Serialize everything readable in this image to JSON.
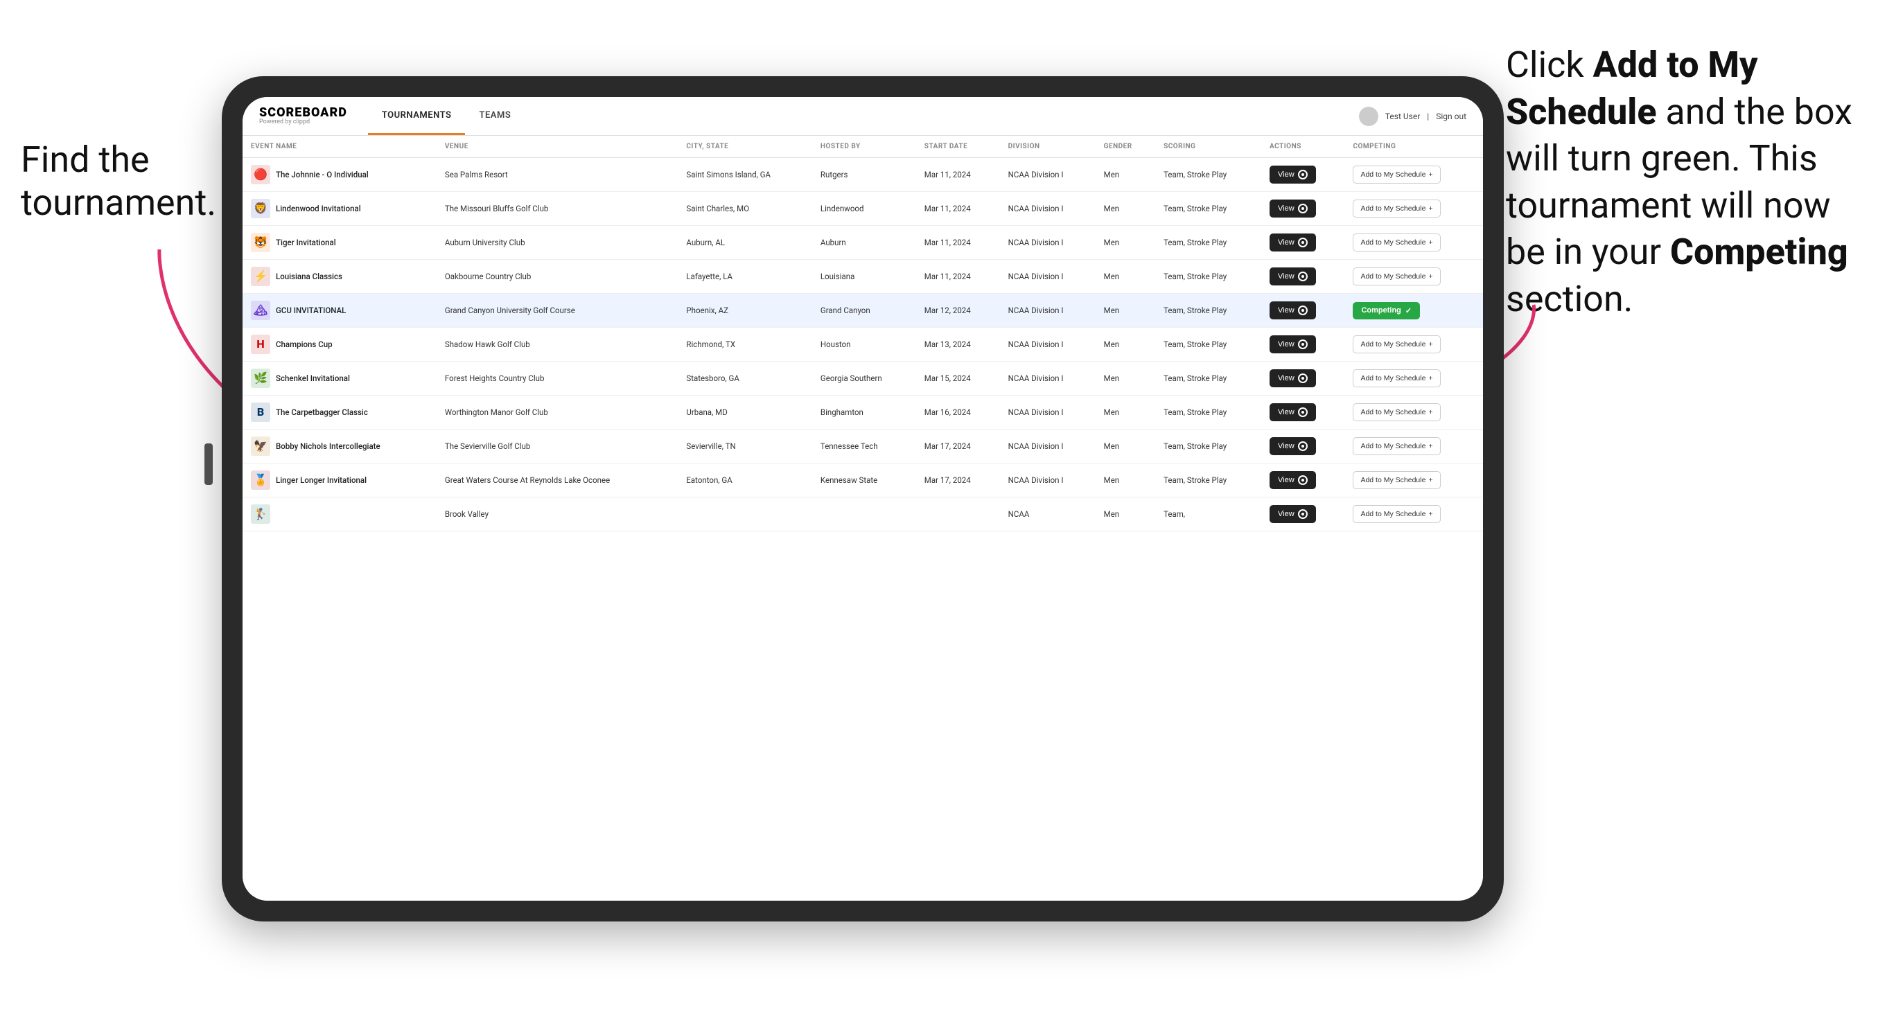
{
  "instructions": {
    "left_text": "Find the tournament.",
    "right_line1": "Click ",
    "right_bold1": "Add to My Schedule",
    "right_line2": " and the box will turn green. This tournament will now be in your ",
    "right_bold2": "Competing",
    "right_line3": " section."
  },
  "app": {
    "logo": "SCOREBOARD",
    "logo_sub": "Powered by clippd",
    "nav_tabs": [
      "TOURNAMENTS",
      "TEAMS"
    ],
    "active_tab": "TOURNAMENTS",
    "user_label": "Test User",
    "signout_label": "Sign out"
  },
  "table": {
    "columns": [
      "EVENT NAME",
      "VENUE",
      "CITY, STATE",
      "HOSTED BY",
      "START DATE",
      "DIVISION",
      "GENDER",
      "SCORING",
      "ACTIONS",
      "COMPETING"
    ],
    "rows": [
      {
        "logo_emoji": "🔴",
        "logo_color": "#cc0000",
        "event_name": "The Johnnie - O Individual",
        "venue": "Sea Palms Resort",
        "city_state": "Saint Simons Island, GA",
        "hosted_by": "Rutgers",
        "start_date": "Mar 11, 2024",
        "division": "NCAA Division I",
        "gender": "Men",
        "scoring": "Team, Stroke Play",
        "competing_status": "add",
        "highlighted": false
      },
      {
        "logo_emoji": "🦁",
        "logo_color": "#2244aa",
        "event_name": "Lindenwood Invitational",
        "venue": "The Missouri Bluffs Golf Club",
        "city_state": "Saint Charles, MO",
        "hosted_by": "Lindenwood",
        "start_date": "Mar 11, 2024",
        "division": "NCAA Division I",
        "gender": "Men",
        "scoring": "Team, Stroke Play",
        "competing_status": "add",
        "highlighted": false
      },
      {
        "logo_emoji": "🐯",
        "logo_color": "#ff6600",
        "event_name": "Tiger Invitational",
        "venue": "Auburn University Club",
        "city_state": "Auburn, AL",
        "hosted_by": "Auburn",
        "start_date": "Mar 11, 2024",
        "division": "NCAA Division I",
        "gender": "Men",
        "scoring": "Team, Stroke Play",
        "competing_status": "add",
        "highlighted": false
      },
      {
        "logo_emoji": "⚡",
        "logo_color": "#aa0000",
        "event_name": "Louisiana Classics",
        "venue": "Oakbourne Country Club",
        "city_state": "Lafayette, LA",
        "hosted_by": "Louisiana",
        "start_date": "Mar 11, 2024",
        "division": "NCAA Division I",
        "gender": "Men",
        "scoring": "Team, Stroke Play",
        "competing_status": "add",
        "highlighted": false
      },
      {
        "logo_emoji": "🏔",
        "logo_color": "#6633cc",
        "event_name": "GCU INVITATIONAL",
        "venue": "Grand Canyon University Golf Course",
        "city_state": "Phoenix, AZ",
        "hosted_by": "Grand Canyon",
        "start_date": "Mar 12, 2024",
        "division": "NCAA Division I",
        "gender": "Men",
        "scoring": "Team, Stroke Play",
        "competing_status": "competing",
        "highlighted": true
      },
      {
        "logo_emoji": "H",
        "logo_color": "#cc0000",
        "event_name": "Champions Cup",
        "venue": "Shadow Hawk Golf Club",
        "city_state": "Richmond, TX",
        "hosted_by": "Houston",
        "start_date": "Mar 13, 2024",
        "division": "NCAA Division I",
        "gender": "Men",
        "scoring": "Team, Stroke Play",
        "competing_status": "add",
        "highlighted": false
      },
      {
        "logo_emoji": "🌿",
        "logo_color": "#007700",
        "event_name": "Schenkel Invitational",
        "venue": "Forest Heights Country Club",
        "city_state": "Statesboro, GA",
        "hosted_by": "Georgia Southern",
        "start_date": "Mar 15, 2024",
        "division": "NCAA Division I",
        "gender": "Men",
        "scoring": "Team, Stroke Play",
        "competing_status": "add",
        "highlighted": false
      },
      {
        "logo_emoji": "B",
        "logo_color": "#003366",
        "event_name": "The Carpetbagger Classic",
        "venue": "Worthington Manor Golf Club",
        "city_state": "Urbana, MD",
        "hosted_by": "Binghamton",
        "start_date": "Mar 16, 2024",
        "division": "NCAA Division I",
        "gender": "Men",
        "scoring": "Team, Stroke Play",
        "competing_status": "add",
        "highlighted": false
      },
      {
        "logo_emoji": "🦅",
        "logo_color": "#aa6600",
        "event_name": "Bobby Nichols Intercollegiate",
        "venue": "The Sevierville Golf Club",
        "city_state": "Sevierville, TN",
        "hosted_by": "Tennessee Tech",
        "start_date": "Mar 17, 2024",
        "division": "NCAA Division I",
        "gender": "Men",
        "scoring": "Team, Stroke Play",
        "competing_status": "add",
        "highlighted": false
      },
      {
        "logo_emoji": "🏅",
        "logo_color": "#880000",
        "event_name": "Linger Longer Invitational",
        "venue": "Great Waters Course At Reynolds Lake Oconee",
        "city_state": "Eatonton, GA",
        "hosted_by": "Kennesaw State",
        "start_date": "Mar 17, 2024",
        "division": "NCAA Division I",
        "gender": "Men",
        "scoring": "Team, Stroke Play",
        "competing_status": "add",
        "highlighted": false
      },
      {
        "logo_emoji": "🏌",
        "logo_color": "#006633",
        "event_name": "",
        "venue": "Brook Valley",
        "city_state": "",
        "hosted_by": "",
        "start_date": "",
        "division": "NCAA",
        "gender": "Men",
        "scoring": "Team,",
        "competing_status": "add",
        "highlighted": false
      }
    ],
    "view_btn_label": "View",
    "add_btn_label": "Add to My Schedule",
    "add_plus": "+",
    "competing_label": "Competing",
    "competing_check": "✓"
  }
}
